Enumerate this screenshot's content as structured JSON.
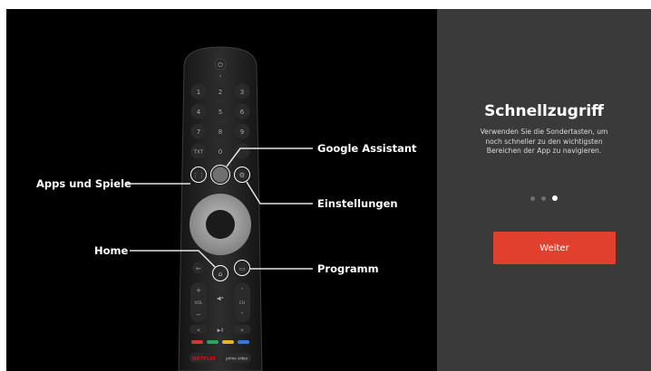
{
  "remote": {
    "power_symbol": "⏻",
    "digits": [
      "1",
      "2",
      "3",
      "4",
      "5",
      "6",
      "7",
      "8",
      "9"
    ],
    "txt_label": "TXT",
    "zero_label": "0",
    "vol_plus": "+",
    "vol_label": "VOL",
    "vol_minus": "−",
    "ch_label": "CH",
    "rewind": "«",
    "play_pause": "▶II",
    "forward": "»",
    "netflix_label": "NETFLIX",
    "prime_label": "prime video",
    "color_keys": [
      "#d23a3a",
      "#2fa35a",
      "#e0b52f",
      "#3a78d2"
    ]
  },
  "callouts": {
    "apps": "Apps und Spiele",
    "home": "Home",
    "assistant": "Google Assistant",
    "settings": "Einstellungen",
    "program": "Programm"
  },
  "panel": {
    "title": "Schnellzugriff",
    "description": "Verwenden Sie die Sondertasten, um noch schneller zu den wichtigsten Bereichen der App zu navigieren.",
    "pager_total": 3,
    "pager_active": 3,
    "continue_label": "Weiter"
  }
}
